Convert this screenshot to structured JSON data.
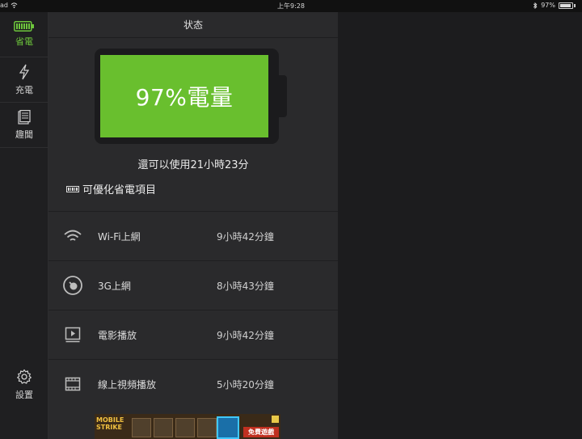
{
  "status_bar": {
    "device": "ad",
    "time": "上午9:28",
    "battery": "97%"
  },
  "sidebar": {
    "items": [
      {
        "label": "省電",
        "icon": "battery-icon",
        "active": true
      },
      {
        "label": "充電",
        "icon": "lightning-icon",
        "active": false
      },
      {
        "label": "趣聞",
        "icon": "news-icon",
        "active": false
      }
    ],
    "settings": {
      "label": "設置",
      "icon": "gear-icon"
    }
  },
  "panel": {
    "title": "状态",
    "battery_label": "97%電量",
    "battery_level": 0.97,
    "remaining": "還可以使用21小時23分",
    "optimize": "可優化省電項目",
    "rows": [
      {
        "name": "Wi-Fi上網",
        "time": "9小時42分鐘",
        "icon": "wifi-icon"
      },
      {
        "name": "3G上網",
        "time": "8小時43分鐘",
        "icon": "cellular-icon"
      },
      {
        "name": "電影播放",
        "time": "9小時42分鐘",
        "icon": "movie-icon"
      },
      {
        "name": "線上視頻播放",
        "time": "5小時20分鐘",
        "icon": "film-strip-icon"
      }
    ]
  },
  "ad": {
    "brand": "MOBILE STRIKE",
    "cta": "免費遊戲"
  },
  "colors": {
    "accent": "#6dc63c",
    "battery_fill": "#69bf2e",
    "panel": "#2a2a2c",
    "background": "#1c1c1e"
  }
}
